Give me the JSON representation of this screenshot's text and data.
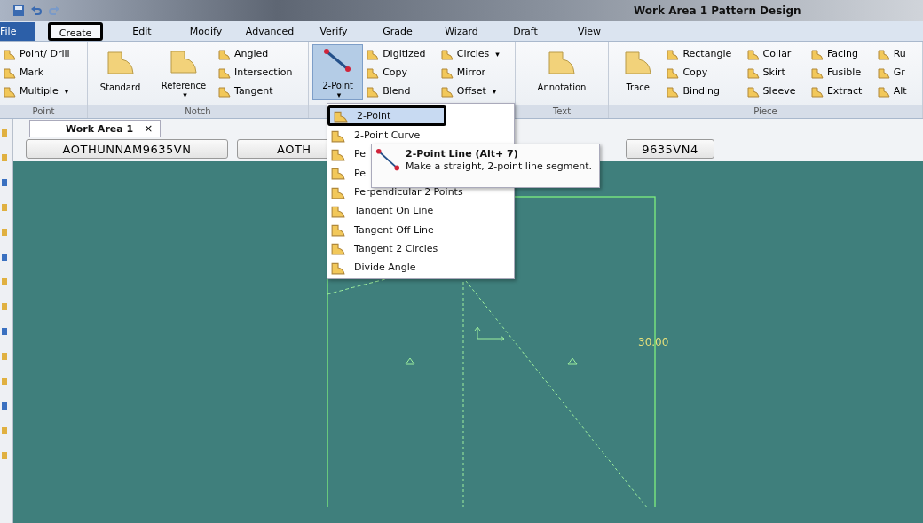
{
  "window": {
    "title": "Work Area 1   Pattern Design"
  },
  "tabs": [
    {
      "label": "File",
      "selected": false,
      "kind": "file"
    },
    {
      "label": "Create",
      "selected": true,
      "kind": "tab"
    },
    {
      "label": "Edit",
      "selected": false,
      "kind": "tab"
    },
    {
      "label": "Modify",
      "selected": false,
      "kind": "tab"
    },
    {
      "label": "Advanced",
      "selected": false,
      "kind": "tab"
    },
    {
      "label": "Verify",
      "selected": false,
      "kind": "tab"
    },
    {
      "label": "Grade",
      "selected": false,
      "kind": "tab"
    },
    {
      "label": "Wizard",
      "selected": false,
      "kind": "tab"
    },
    {
      "label": "Draft",
      "selected": false,
      "kind": "tab"
    },
    {
      "label": "View",
      "selected": false,
      "kind": "tab"
    }
  ],
  "ribbon": [
    {
      "label": "Point",
      "items": [
        {
          "kind": "small",
          "label": "Point/ Drill"
        },
        {
          "kind": "small",
          "label": "Mark"
        },
        {
          "kind": "small",
          "label": "Multiple",
          "caret": "▾"
        }
      ]
    },
    {
      "label": "Notch",
      "items": [
        {
          "kind": "large",
          "label": "Standard",
          "pressed": false
        },
        {
          "kind": "large",
          "label": "Reference",
          "caret": "▾",
          "pressed": false
        },
        {
          "kind": "small",
          "label": "Angled"
        },
        {
          "kind": "small",
          "label": "Intersection"
        },
        {
          "kind": "small",
          "label": "Tangent"
        }
      ]
    },
    {
      "items": [
        {
          "kind": "large",
          "label": "2-Point",
          "caret": "▾",
          "pressed": true
        },
        {
          "kind": "small",
          "label": "Digitized"
        },
        {
          "kind": "small",
          "label": "Copy"
        },
        {
          "kind": "small",
          "label": "Blend"
        },
        {
          "kind": "small",
          "label": "Circles",
          "caret": "▾"
        },
        {
          "kind": "small",
          "label": "Mirror"
        },
        {
          "kind": "small",
          "label": "Offset",
          "caret": "▾"
        }
      ]
    },
    {
      "label": "Text",
      "items": [
        {
          "kind": "large",
          "label": "Annotation",
          "pressed": false
        }
      ]
    },
    {
      "label": "Piece",
      "items": [
        {
          "kind": "large",
          "label": "Trace",
          "pressed": false
        },
        {
          "kind": "small",
          "label": "Rectangle"
        },
        {
          "kind": "small",
          "label": "Copy"
        },
        {
          "kind": "small",
          "label": "Binding"
        },
        {
          "kind": "small",
          "label": "Collar"
        },
        {
          "kind": "small",
          "label": "Skirt"
        },
        {
          "kind": "small",
          "label": "Sleeve"
        },
        {
          "kind": "small",
          "label": "Facing"
        },
        {
          "kind": "small",
          "label": "Fusible"
        },
        {
          "kind": "small",
          "label": "Extract"
        },
        {
          "kind": "small",
          "label": "Ru"
        },
        {
          "kind": "small",
          "label": "Gr"
        },
        {
          "kind": "small",
          "label": "Alt"
        }
      ]
    }
  ],
  "work_area_tab": {
    "label": "Work Area 1",
    "close": "×"
  },
  "pieces": [
    "AOTHUNNAM9635VN",
    "AOTH",
    "9635VN4"
  ],
  "menu": [
    {
      "label": "2-Point",
      "selected": true
    },
    {
      "label": "2-Point Curve",
      "selected": false
    },
    {
      "label": "Pe",
      "selected": false
    },
    {
      "label": "Pe",
      "selected": false
    },
    {
      "label": "Perpendicular 2 Points",
      "selected": false
    },
    {
      "label": "Tangent On Line",
      "selected": false
    },
    {
      "label": "Tangent Off Line",
      "selected": false
    },
    {
      "label": "Tangent 2 Circles",
      "selected": false
    },
    {
      "label": "Divide Angle",
      "selected": false
    }
  ],
  "tooltip": {
    "title": "2-Point Line (Alt+ 7)",
    "text": "Make a straight, 2-point line segment."
  },
  "canvas": {
    "dimension": "30.00"
  }
}
